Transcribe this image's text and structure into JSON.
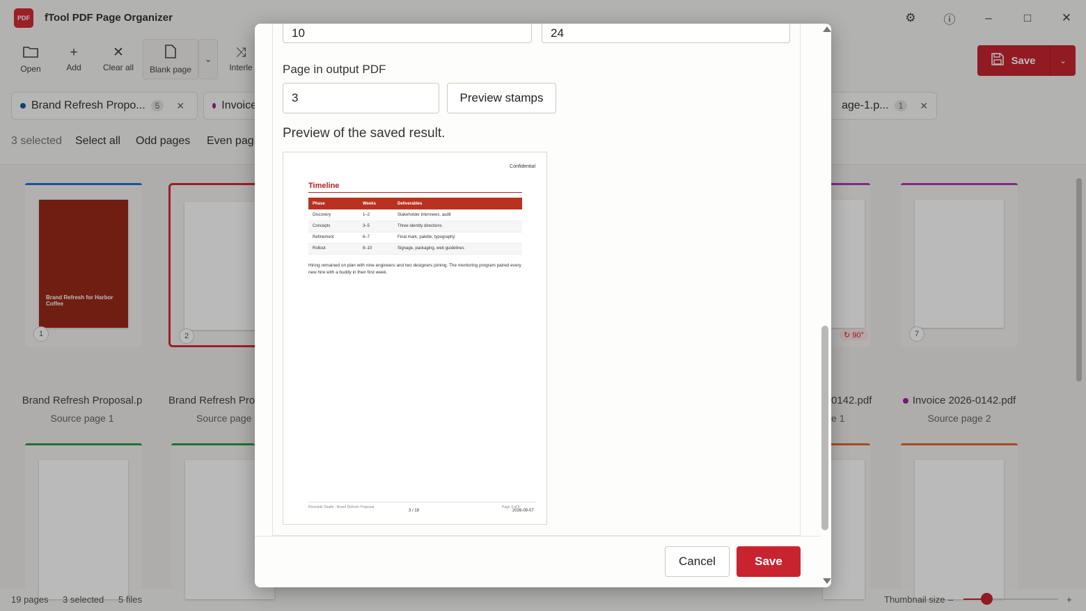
{
  "app": {
    "title": "fTool PDF Page Organizer",
    "logo_text": "PDF"
  },
  "window": {
    "settings_icon": "⚙",
    "info_icon": "ⓘ",
    "minimize_icon": "–",
    "maximize_icon": "□",
    "close_icon": "✕"
  },
  "toolbar": {
    "open": "Open",
    "add": "Add",
    "clear_all": "Clear all",
    "blank_page": "Blank page",
    "interleave": "Interle",
    "save": "Save",
    "dropdown_icon": "⌄"
  },
  "tabs": [
    {
      "name": "Brand Refresh Propo...",
      "count": "5",
      "color": "#1a56b0"
    },
    {
      "name": "Invoice",
      "color": "#a020a0"
    },
    {
      "name": "age-1.p...",
      "count": "1"
    }
  ],
  "selection": {
    "count_label": "3 selected",
    "select_all": "Select all",
    "odd_pages": "Odd pages",
    "even_pages": "Even pag"
  },
  "cards": [
    {
      "num": "1",
      "file": "Brand Refresh Proposal.p",
      "source": "Source page 1",
      "strip_color": "#2a6fd6",
      "cover_text": "Brand Refresh for Harbor Coffee"
    },
    {
      "num": "2",
      "file": "Brand Refresh Pro",
      "source": "Source page",
      "strip_color": "#2a6fd6"
    },
    {
      "file": "0142.pdf",
      "source": "e 1",
      "strip_color": "#b03ab0",
      "rotation": "↻ 90°"
    },
    {
      "num": "7",
      "file": "Invoice 2026-0142.pdf",
      "source": "Source page 2",
      "strip_color": "#b03ab0"
    }
  ],
  "status": {
    "pages": "19 pages",
    "selected": "3 selected",
    "files": "5 files",
    "thumbnail_size": "Thumbnail size",
    "zoom_out": "–",
    "zoom_in": "+",
    "thumb_size_fraction": 0.25
  },
  "dialog": {
    "field_a": "10",
    "field_b": "24",
    "page_in_output_label": "Page in output PDF",
    "page_in_output_value": "3",
    "preview_stamps": "Preview stamps",
    "preview_label": "Preview of the saved result.",
    "cancel": "Cancel",
    "save": "Save"
  },
  "preview_page": {
    "stamp_top": "Confidential",
    "title": "Timeline",
    "table_headers": [
      "Phase",
      "Weeks",
      "Deliverables"
    ],
    "rows": [
      [
        "Discovery",
        "1–2",
        "Stakeholder interviews, audit"
      ],
      [
        "Concepts",
        "3–5",
        "Three identity directions"
      ],
      [
        "Refinement",
        "6–7",
        "Final mark, palette, typography"
      ],
      [
        "Rollout",
        "8–10",
        "Signage, packaging, web guidelines"
      ]
    ],
    "body": "Hiring remained on plan with nine engineers and two designers joining. The mentoring program paired every new hire with a buddy in their first week.",
    "footer_left": "Riverside Studio · Brand Refresh Proposal",
    "footer_center": "3 / 19",
    "footer_right": "Page 3 of 5",
    "footer_date": "2026-09-07"
  },
  "colors": {
    "accent": "#c8242f"
  }
}
